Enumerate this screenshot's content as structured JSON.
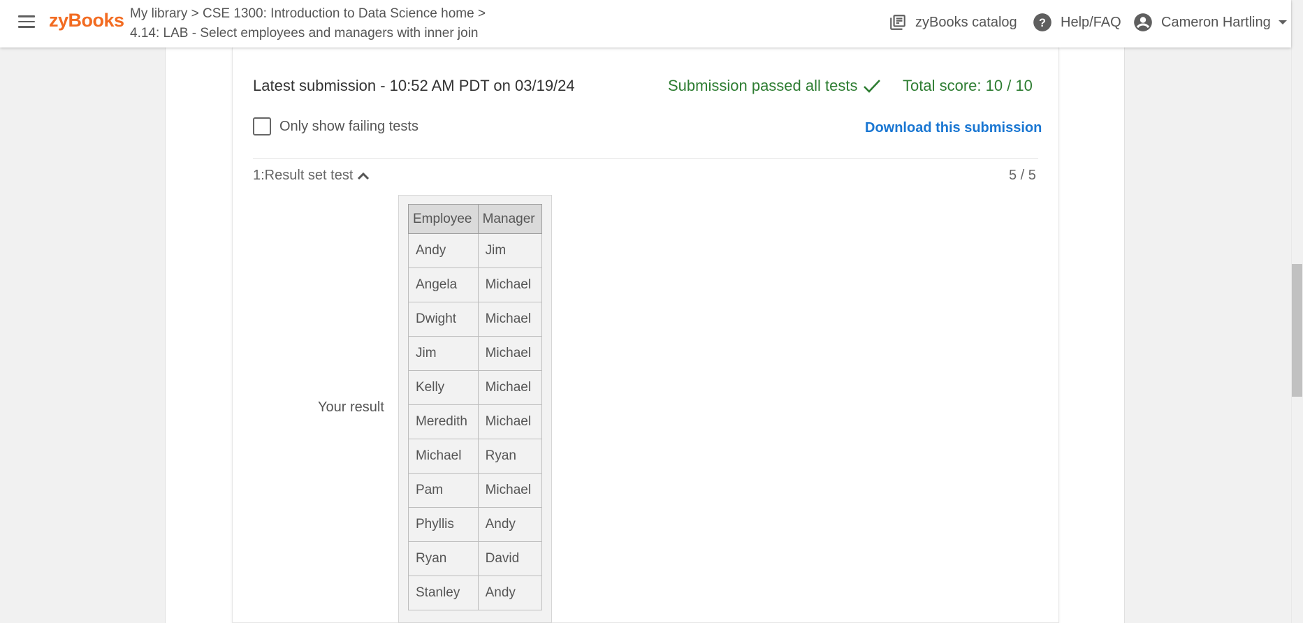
{
  "header": {
    "logo": "zyBooks",
    "breadcrumb_line1": "My library > CSE 1300: Introduction to Data Science home >",
    "breadcrumb_line2": "4.14: LAB - Select employees and managers with inner join",
    "catalog_label": "zyBooks catalog",
    "help_label": "Help/FAQ",
    "user_name": "Cameron Hartling"
  },
  "submission": {
    "latest": "Latest submission - 10:52 AM PDT on 03/19/24",
    "passed": "Submission passed all tests",
    "total": "Total score: 10 / 10",
    "only_failing": "Only show failing tests",
    "download": "Download this submission"
  },
  "test": {
    "title": "1:Result set test",
    "score": "5 / 5",
    "your_result_label": "Your result",
    "columns": [
      "Employee",
      "Manager"
    ],
    "rows": [
      [
        "Andy",
        "Jim"
      ],
      [
        "Angela",
        "Michael"
      ],
      [
        "Dwight",
        "Michael"
      ],
      [
        "Jim",
        "Michael"
      ],
      [
        "Kelly",
        "Michael"
      ],
      [
        "Meredith",
        "Michael"
      ],
      [
        "Michael",
        "Ryan"
      ],
      [
        "Pam",
        "Michael"
      ],
      [
        "Phyllis",
        "Andy"
      ],
      [
        "Ryan",
        "David"
      ],
      [
        "Stanley",
        "Andy"
      ]
    ]
  },
  "colors": {
    "brand": "#f26b21",
    "success": "#2e7d32",
    "link": "#1976d2"
  }
}
